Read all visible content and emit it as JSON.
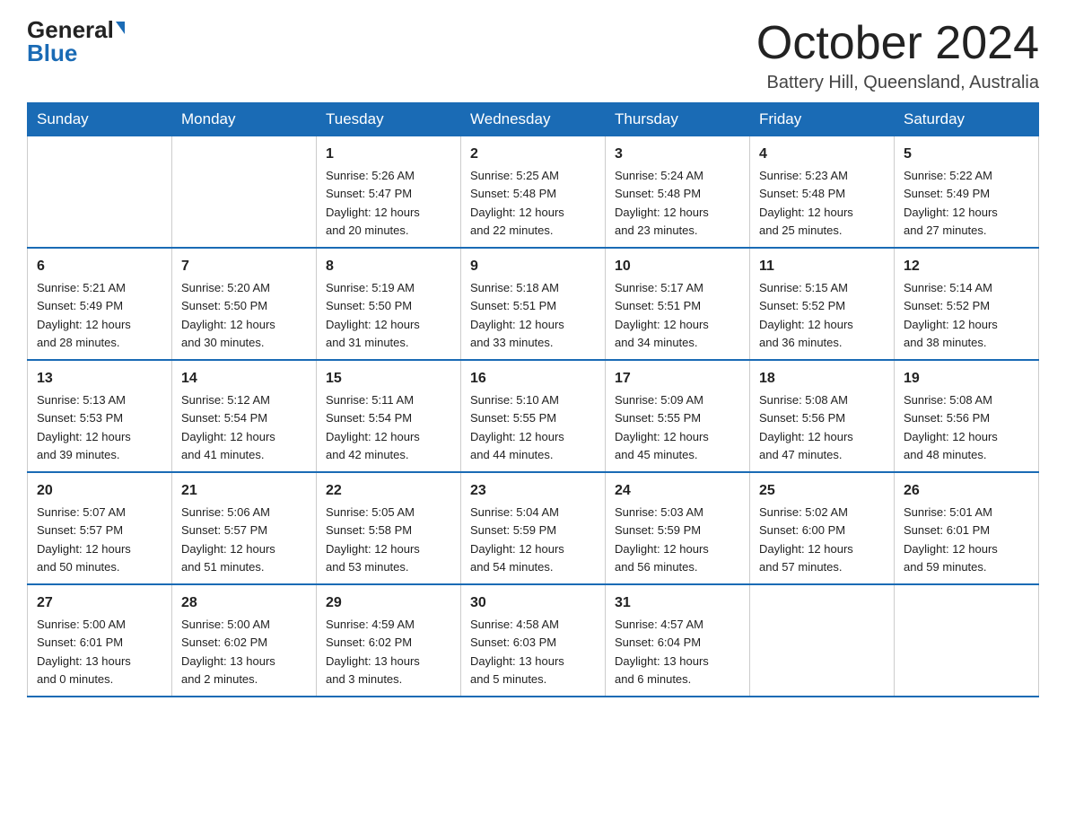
{
  "logo": {
    "general": "General",
    "blue": "Blue"
  },
  "header": {
    "month": "October 2024",
    "location": "Battery Hill, Queensland, Australia"
  },
  "weekdays": [
    "Sunday",
    "Monday",
    "Tuesday",
    "Wednesday",
    "Thursday",
    "Friday",
    "Saturday"
  ],
  "weeks": [
    [
      {
        "day": "",
        "info": ""
      },
      {
        "day": "",
        "info": ""
      },
      {
        "day": "1",
        "info": "Sunrise: 5:26 AM\nSunset: 5:47 PM\nDaylight: 12 hours\nand 20 minutes."
      },
      {
        "day": "2",
        "info": "Sunrise: 5:25 AM\nSunset: 5:48 PM\nDaylight: 12 hours\nand 22 minutes."
      },
      {
        "day": "3",
        "info": "Sunrise: 5:24 AM\nSunset: 5:48 PM\nDaylight: 12 hours\nand 23 minutes."
      },
      {
        "day": "4",
        "info": "Sunrise: 5:23 AM\nSunset: 5:48 PM\nDaylight: 12 hours\nand 25 minutes."
      },
      {
        "day": "5",
        "info": "Sunrise: 5:22 AM\nSunset: 5:49 PM\nDaylight: 12 hours\nand 27 minutes."
      }
    ],
    [
      {
        "day": "6",
        "info": "Sunrise: 5:21 AM\nSunset: 5:49 PM\nDaylight: 12 hours\nand 28 minutes."
      },
      {
        "day": "7",
        "info": "Sunrise: 5:20 AM\nSunset: 5:50 PM\nDaylight: 12 hours\nand 30 minutes."
      },
      {
        "day": "8",
        "info": "Sunrise: 5:19 AM\nSunset: 5:50 PM\nDaylight: 12 hours\nand 31 minutes."
      },
      {
        "day": "9",
        "info": "Sunrise: 5:18 AM\nSunset: 5:51 PM\nDaylight: 12 hours\nand 33 minutes."
      },
      {
        "day": "10",
        "info": "Sunrise: 5:17 AM\nSunset: 5:51 PM\nDaylight: 12 hours\nand 34 minutes."
      },
      {
        "day": "11",
        "info": "Sunrise: 5:15 AM\nSunset: 5:52 PM\nDaylight: 12 hours\nand 36 minutes."
      },
      {
        "day": "12",
        "info": "Sunrise: 5:14 AM\nSunset: 5:52 PM\nDaylight: 12 hours\nand 38 minutes."
      }
    ],
    [
      {
        "day": "13",
        "info": "Sunrise: 5:13 AM\nSunset: 5:53 PM\nDaylight: 12 hours\nand 39 minutes."
      },
      {
        "day": "14",
        "info": "Sunrise: 5:12 AM\nSunset: 5:54 PM\nDaylight: 12 hours\nand 41 minutes."
      },
      {
        "day": "15",
        "info": "Sunrise: 5:11 AM\nSunset: 5:54 PM\nDaylight: 12 hours\nand 42 minutes."
      },
      {
        "day": "16",
        "info": "Sunrise: 5:10 AM\nSunset: 5:55 PM\nDaylight: 12 hours\nand 44 minutes."
      },
      {
        "day": "17",
        "info": "Sunrise: 5:09 AM\nSunset: 5:55 PM\nDaylight: 12 hours\nand 45 minutes."
      },
      {
        "day": "18",
        "info": "Sunrise: 5:08 AM\nSunset: 5:56 PM\nDaylight: 12 hours\nand 47 minutes."
      },
      {
        "day": "19",
        "info": "Sunrise: 5:08 AM\nSunset: 5:56 PM\nDaylight: 12 hours\nand 48 minutes."
      }
    ],
    [
      {
        "day": "20",
        "info": "Sunrise: 5:07 AM\nSunset: 5:57 PM\nDaylight: 12 hours\nand 50 minutes."
      },
      {
        "day": "21",
        "info": "Sunrise: 5:06 AM\nSunset: 5:57 PM\nDaylight: 12 hours\nand 51 minutes."
      },
      {
        "day": "22",
        "info": "Sunrise: 5:05 AM\nSunset: 5:58 PM\nDaylight: 12 hours\nand 53 minutes."
      },
      {
        "day": "23",
        "info": "Sunrise: 5:04 AM\nSunset: 5:59 PM\nDaylight: 12 hours\nand 54 minutes."
      },
      {
        "day": "24",
        "info": "Sunrise: 5:03 AM\nSunset: 5:59 PM\nDaylight: 12 hours\nand 56 minutes."
      },
      {
        "day": "25",
        "info": "Sunrise: 5:02 AM\nSunset: 6:00 PM\nDaylight: 12 hours\nand 57 minutes."
      },
      {
        "day": "26",
        "info": "Sunrise: 5:01 AM\nSunset: 6:01 PM\nDaylight: 12 hours\nand 59 minutes."
      }
    ],
    [
      {
        "day": "27",
        "info": "Sunrise: 5:00 AM\nSunset: 6:01 PM\nDaylight: 13 hours\nand 0 minutes."
      },
      {
        "day": "28",
        "info": "Sunrise: 5:00 AM\nSunset: 6:02 PM\nDaylight: 13 hours\nand 2 minutes."
      },
      {
        "day": "29",
        "info": "Sunrise: 4:59 AM\nSunset: 6:02 PM\nDaylight: 13 hours\nand 3 minutes."
      },
      {
        "day": "30",
        "info": "Sunrise: 4:58 AM\nSunset: 6:03 PM\nDaylight: 13 hours\nand 5 minutes."
      },
      {
        "day": "31",
        "info": "Sunrise: 4:57 AM\nSunset: 6:04 PM\nDaylight: 13 hours\nand 6 minutes."
      },
      {
        "day": "",
        "info": ""
      },
      {
        "day": "",
        "info": ""
      }
    ]
  ]
}
